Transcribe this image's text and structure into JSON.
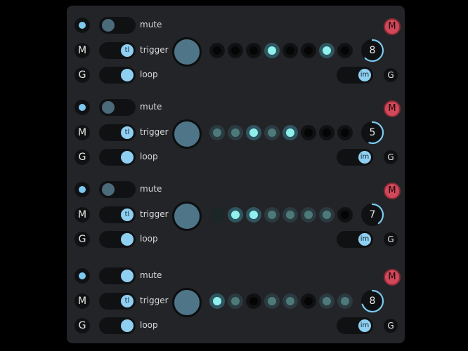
{
  "tracks": [
    {
      "mute_label": "mute",
      "trigger_label": "trigger",
      "loop_label": "loop",
      "m_label": "M",
      "g_label": "G",
      "tl_label": "tl",
      "im_label": "im",
      "mute_badge": "M",
      "mute_on": false,
      "trigger_on": true,
      "loop_on": true,
      "steps": [
        0,
        0,
        0,
        2,
        0,
        0,
        2,
        0
      ],
      "count": "8",
      "progress": 0.62
    },
    {
      "mute_label": "mute",
      "trigger_label": "trigger",
      "loop_label": "loop",
      "m_label": "M",
      "g_label": "G",
      "tl_label": "tl",
      "im_label": "im",
      "mute_badge": "M",
      "mute_on": false,
      "trigger_on": true,
      "loop_on": true,
      "steps": [
        1,
        1,
        2,
        1,
        2,
        0,
        0,
        0
      ],
      "count": "5",
      "progress": 0.55
    },
    {
      "mute_label": "mute",
      "trigger_label": "trigger",
      "loop_label": "loop",
      "m_label": "M",
      "g_label": "G",
      "tl_label": "tl",
      "im_label": "im",
      "mute_badge": "M",
      "mute_on": false,
      "trigger_on": true,
      "loop_on": true,
      "steps": [
        3,
        2,
        2,
        1,
        1,
        1,
        1,
        0
      ],
      "count": "7",
      "progress": 0.4
    },
    {
      "mute_label": "mute",
      "trigger_label": "trigger",
      "loop_label": "loop",
      "m_label": "M",
      "g_label": "G",
      "tl_label": "tl",
      "im_label": "im",
      "mute_badge": "M",
      "mute_on": true,
      "trigger_on": true,
      "loop_on": true,
      "steps": [
        2,
        1,
        0,
        1,
        1,
        0,
        1,
        1
      ],
      "count": "8",
      "progress": 0.7
    }
  ],
  "colors": {
    "panel": "#232427",
    "accent": "#7ccaf0",
    "active_step": "#8ff0ec",
    "mute_badge": "#d0485a"
  }
}
